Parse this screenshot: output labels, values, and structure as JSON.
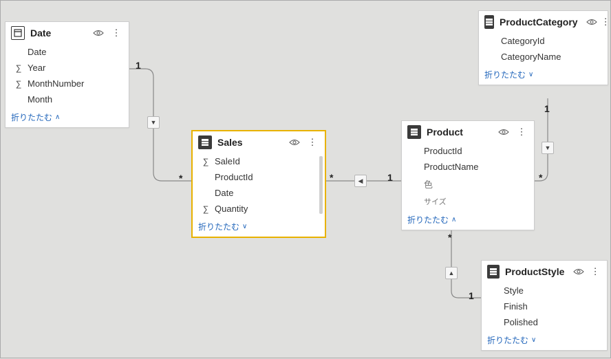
{
  "collapse_label": "折りたたむ",
  "tables": {
    "date": {
      "title": "Date",
      "fields": [
        "Date",
        "Year",
        "MonthNumber",
        "Month"
      ],
      "sigma": [
        false,
        true,
        true,
        false
      ]
    },
    "sales": {
      "title": "Sales",
      "fields": [
        "SaleId",
        "ProductId",
        "Date",
        "Quantity"
      ],
      "sigma": [
        true,
        false,
        false,
        true
      ]
    },
    "product": {
      "title": "Product",
      "fields": [
        "ProductId",
        "ProductName",
        "色",
        "サイズ"
      ],
      "jp": [
        false,
        false,
        true,
        true
      ]
    },
    "productCategory": {
      "title": "ProductCategory",
      "fields": [
        "CategoryId",
        "CategoryName"
      ]
    },
    "productStyle": {
      "title": "ProductStyle",
      "fields": [
        "Style",
        "Finish",
        "Polished"
      ]
    }
  },
  "cardinality": {
    "one": "1",
    "many": "*"
  },
  "relationships": [
    {
      "from": "date",
      "to": "sales",
      "from_card": "1",
      "to_card": "*"
    },
    {
      "from": "product",
      "to": "sales",
      "from_card": "1",
      "to_card": "*"
    },
    {
      "from": "productCategory",
      "to": "product",
      "from_card": "1",
      "to_card": "*"
    },
    {
      "from": "productStyle",
      "to": "product",
      "from_card": "1",
      "to_card": "*"
    }
  ],
  "icons": {
    "visibility": "visibility-icon",
    "more": "more-icon",
    "chevron_up": "chevron-up-icon",
    "chevron_down": "chevron-down-icon",
    "table_dim": "dimension-table-icon",
    "table_fact": "fact-table-icon",
    "sigma": "sigma-icon"
  }
}
